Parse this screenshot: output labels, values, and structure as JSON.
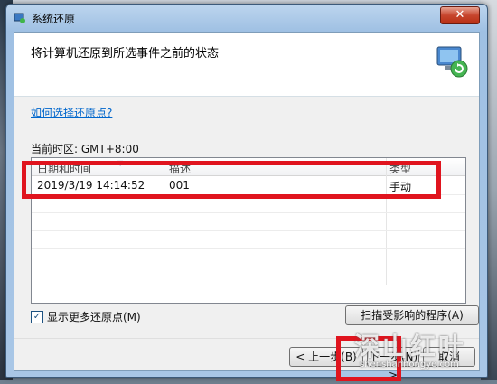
{
  "window": {
    "title": "系统还原",
    "close_label": "✕"
  },
  "header": {
    "heading": "将计算机还原到所选事件之前的状态",
    "icon": "system-restore-icon"
  },
  "help_link": "如何选择还原点?",
  "timezone": "当前时区: GMT+8:00",
  "table": {
    "columns": [
      "日期和时间",
      "描述",
      "类型"
    ],
    "rows": [
      {
        "datetime": "2019/3/19 14:14:52",
        "description": "001",
        "type": "手动"
      }
    ]
  },
  "show_more": {
    "label": "显示更多还原点(M)",
    "checked": true
  },
  "buttons": {
    "scan": "扫描受影响的程序(A)",
    "back": "< 上一步(B)",
    "next": "下一步(N) >",
    "cancel": "取消"
  },
  "watermark": {
    "brand": "深山红叶",
    "url": "shenshanhongye.com"
  },
  "colors": {
    "highlight": "#e0141e",
    "link": "#0066cc"
  }
}
